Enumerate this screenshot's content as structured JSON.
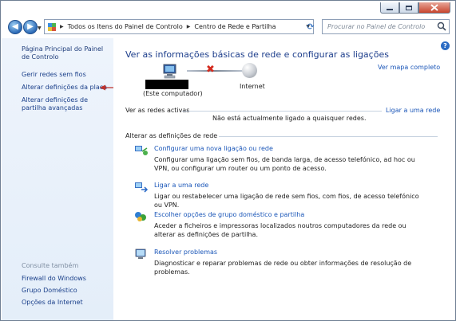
{
  "breadcrumb": {
    "items": [
      "Todos os Itens do Painel de Controlo",
      "Centro de Rede e Partilha"
    ]
  },
  "search": {
    "placeholder": "Procurar no Painel de Controlo"
  },
  "sidebar": {
    "home": "Página Principal do Painel de Controlo",
    "links": [
      "Gerir redes sem fios",
      "Alterar definições da placa",
      "Alterar definições de partilha avançadas"
    ],
    "see_also_header": "Consulte também",
    "see_also": [
      "Firewall do Windows",
      "Grupo Doméstico",
      "Opções da Internet"
    ]
  },
  "main": {
    "title": "Ver as informações básicas de rede e configurar as ligações",
    "map_link": "Ver mapa completo",
    "network_map": {
      "computer_label": "(Este computador)",
      "internet_label": "Internet"
    },
    "active_networks": {
      "label": "Ver as redes activas",
      "connect_link": "Ligar a uma rede",
      "status": "Não está actualmente ligado a quaisquer redes."
    },
    "change_settings": {
      "label": "Alterar as definições de rede",
      "tasks": [
        {
          "title": "Configurar uma nova ligação ou rede",
          "desc": "Configurar uma ligação sem fios, de banda larga, de acesso telefónico, ad hoc ou VPN, ou configurar um router ou um ponto de acesso."
        },
        {
          "title": "Ligar a uma rede",
          "desc": "Ligar ou restabelecer uma ligação de rede sem fios, com fios, de acesso telefónico ou VPN."
        },
        {
          "title": "Escolher opções de grupo doméstico e partilha",
          "desc": "Aceder a ficheiros e impressoras localizados noutros computadores da rede ou alterar as definições de partilha."
        },
        {
          "title": "Resolver problemas",
          "desc": "Diagnosticar e reparar problemas de rede ou obter informações de resolução de problemas."
        }
      ]
    }
  },
  "colors": {
    "link": "#1a56b8",
    "title": "#1c3d8b",
    "annotation_arrow": "#c0312a",
    "disconnected": "#d42a1e"
  }
}
